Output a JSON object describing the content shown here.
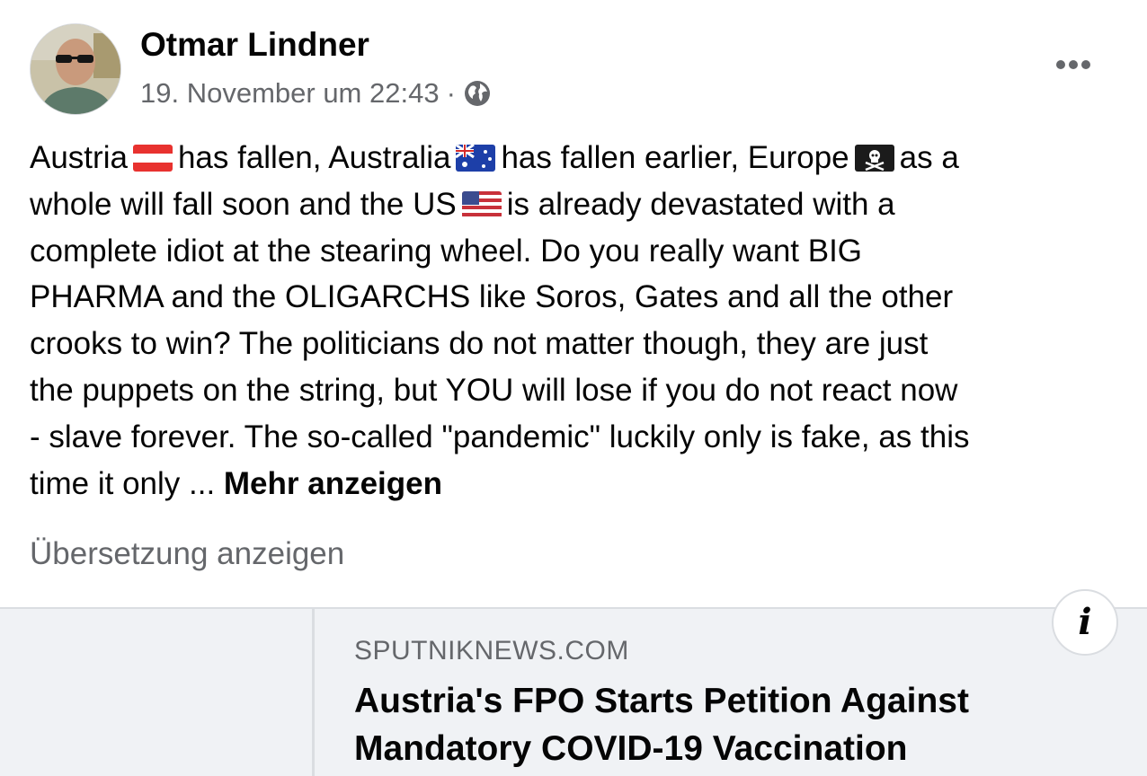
{
  "post": {
    "author": "Otmar Lindner",
    "timestamp": "19. November um 22:43",
    "separator": "·",
    "privacy_icon": "globe-icon",
    "avatar_icon": "profile-photo",
    "more_icon": "more-options-icon",
    "text": {
      "l1_a": "Austria",
      "l1_b": "has fallen, Australia",
      "l1_c": "has fallen earlier, Europe",
      "l1_d": "as a",
      "l2_a": "whole will fall soon and the US",
      "l2_b": "is already devastated with a",
      "l3": "complete idiot at the stearing wheel. Do you really want BIG",
      "l4": "PHARMA and the OLIGARCHS like Soros, Gates and all the other",
      "l5": "crooks to win? The politicians do not matter though, they are just",
      "l6": "the puppets on the string, but YOU will lose if you do not react now",
      "l7": "- slave forever. The so-called \"pandemic\" luckily only is fake, as this",
      "l8": "time it only ... ",
      "see_more": "Mehr anzeigen"
    },
    "flags": [
      "austria-flag",
      "australia-flag",
      "pirate-flag",
      "us-flag"
    ],
    "translate_label": "Übersetzung anzeigen"
  },
  "link_preview": {
    "domain": "SPUTNIKNEWS.COM",
    "title_line1": "Austria's FPO Starts Petition Against",
    "title_line2": "Mandatory COVID-19 Vaccination",
    "info_label": "i"
  },
  "colors": {
    "text": "#050505",
    "secondary_text": "#65676b",
    "card_background": "#f0f2f5",
    "divider": "#dadde1"
  }
}
